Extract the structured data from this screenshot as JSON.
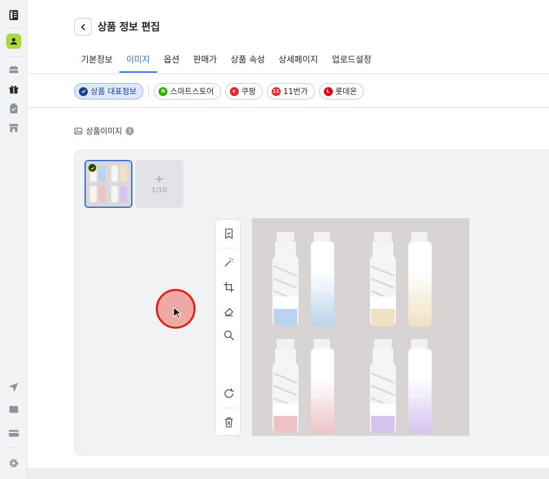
{
  "header": {
    "title": "상품 정보 편집"
  },
  "tabs": [
    {
      "label": "기본정보"
    },
    {
      "label": "이미지"
    },
    {
      "label": "옵션"
    },
    {
      "label": "판매가"
    },
    {
      "label": "상품 속성"
    },
    {
      "label": "상세페이지"
    },
    {
      "label": "업로드설정"
    }
  ],
  "active_tab": "이미지",
  "channels": [
    {
      "label": "상품 대표정보",
      "icon": "check-circle-icon",
      "color": "#1d3f8a"
    },
    {
      "label": "스마트스토어",
      "icon": "naver-n-icon",
      "color": "#2db400"
    },
    {
      "label": "쿠팡",
      "icon": "coupang-icon",
      "color": "#e52528"
    },
    {
      "label": "11번가",
      "icon": "11st-icon",
      "color": "#ef2b2d"
    },
    {
      "label": "롯데온",
      "icon": "lotteon-icon",
      "color": "#e60012"
    }
  ],
  "section": {
    "title": "상품이미지",
    "help": "?"
  },
  "image_slots": {
    "add_plus": "+",
    "count_label": "1/10"
  },
  "toolbar": [
    "bookmark-icon",
    "magic-wand-icon",
    "crop-icon",
    "eraser-icon",
    "zoom-icon",
    "rotate-icon",
    "trash-icon"
  ],
  "product_image": {
    "labels": [
      "UPF 50+",
      "UPF 50+",
      "UPF 50+",
      "UPF 50+"
    ],
    "colors": [
      "#b9d4ec",
      "#efe2c4",
      "#eec3c6",
      "#d3c3ee"
    ]
  },
  "colors": {
    "accent": "#2f6bd8",
    "chip_active_bg": "#dfe8fb",
    "cursor_ring": "#e0221d"
  }
}
